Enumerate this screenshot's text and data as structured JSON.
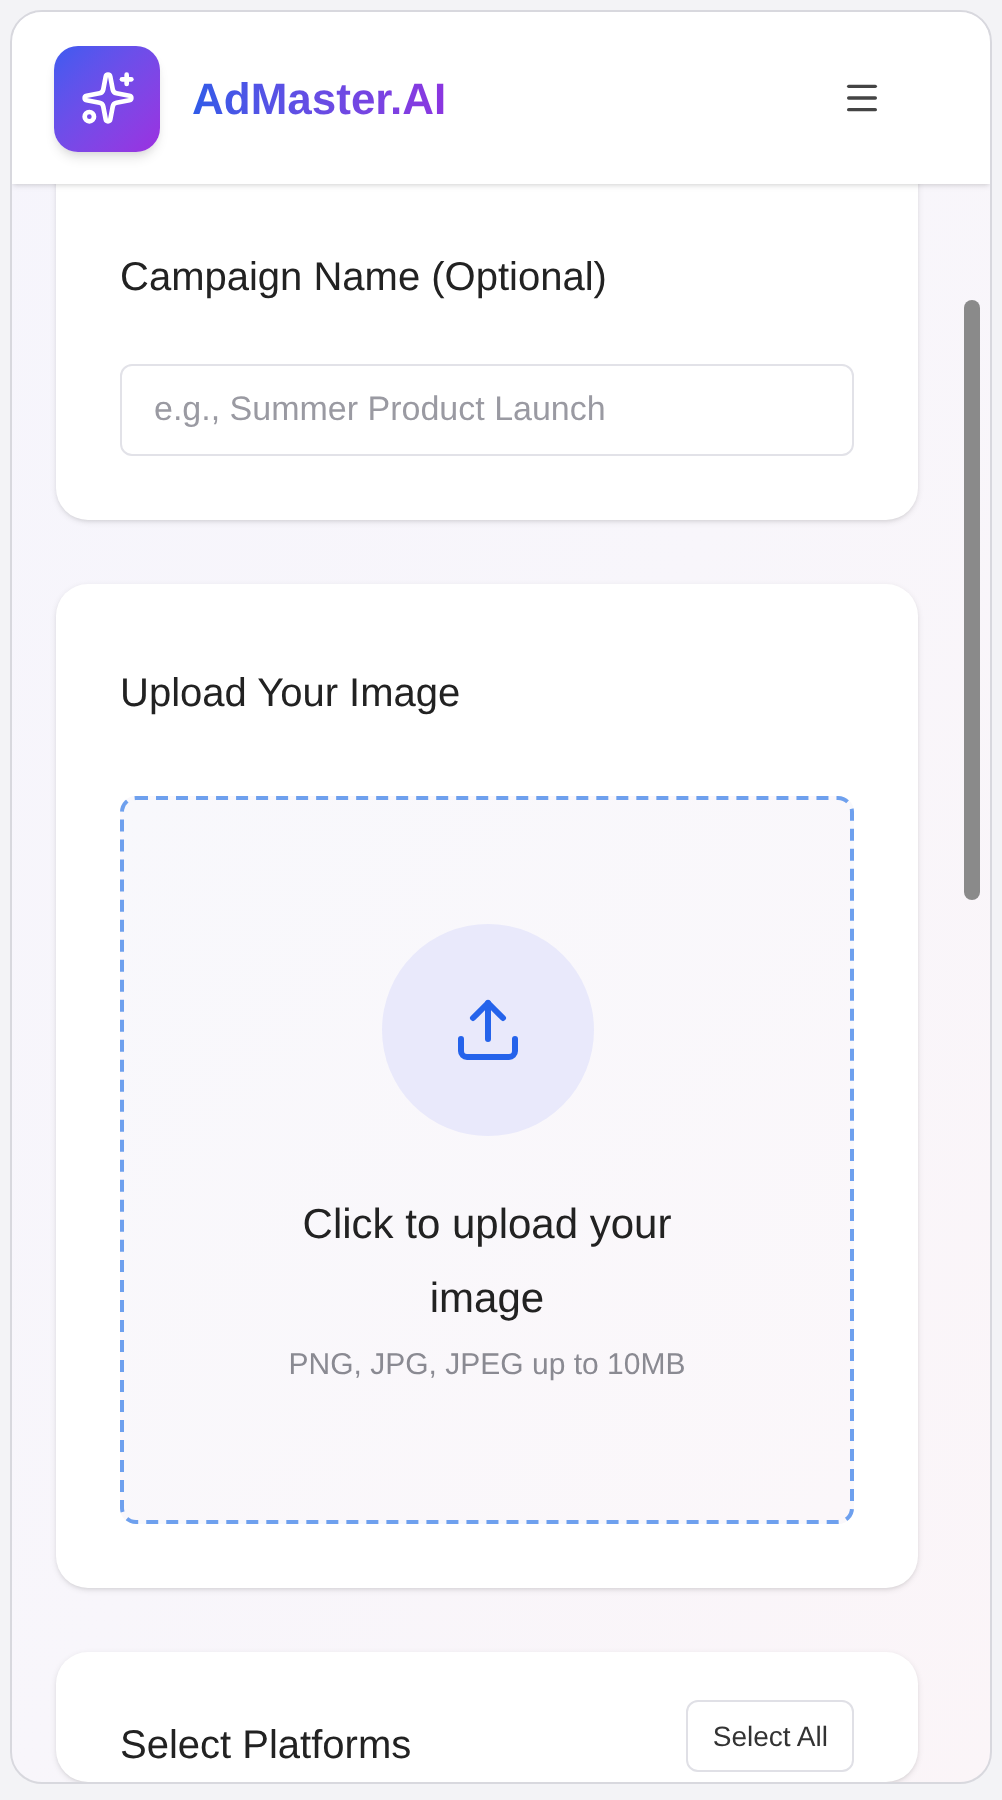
{
  "header": {
    "brand": "AdMaster.AI"
  },
  "campaign": {
    "title": "Campaign Name (Optional)",
    "placeholder": "e.g., Summer Product Launch"
  },
  "upload": {
    "title": "Upload Your Image",
    "prompt": "Click to upload your image",
    "hint": "PNG, JPG, JPEG up to 10MB"
  },
  "platforms": {
    "title": "Select Platforms",
    "select_all": "Select All"
  }
}
